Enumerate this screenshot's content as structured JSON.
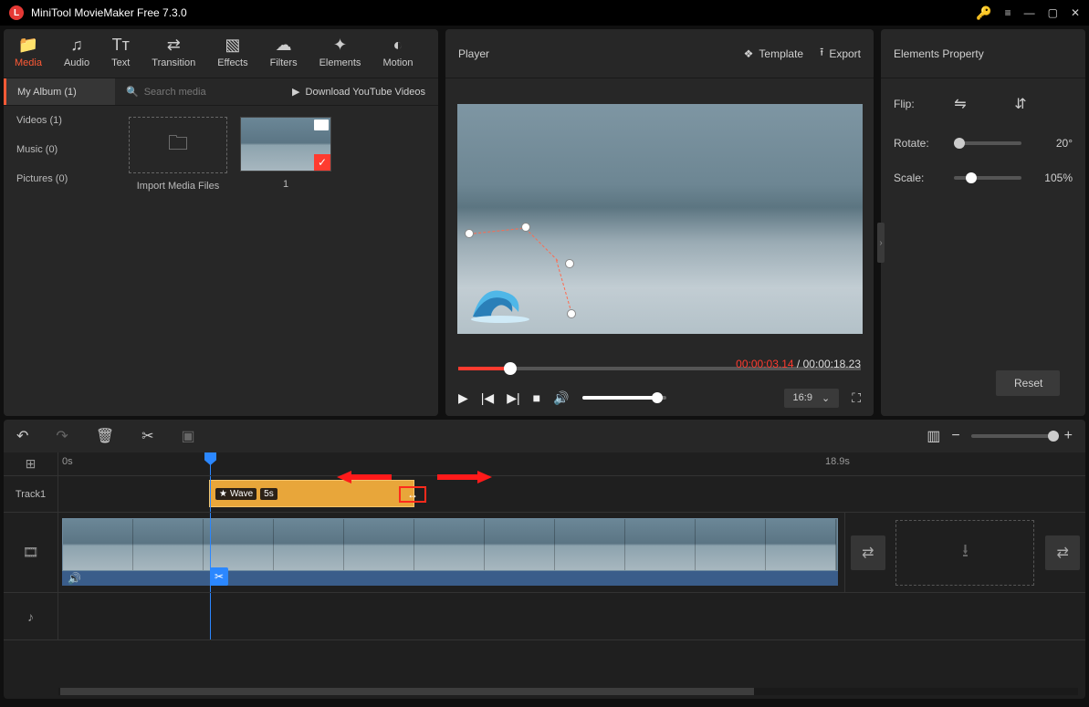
{
  "titlebar": {
    "title": "MiniTool MovieMaker Free 7.3.0"
  },
  "topnav": {
    "media": "Media",
    "audio": "Audio",
    "text": "Text",
    "transition": "Transition",
    "effects": "Effects",
    "filters": "Filters",
    "elements": "Elements",
    "motion": "Motion"
  },
  "mediaSub": {
    "myAlbum": "My Album (1)",
    "searchPlaceholder": "Search media",
    "download": "Download YouTube Videos"
  },
  "mediaSide": {
    "videos": "Videos (1)",
    "music": "Music (0)",
    "pictures": "Pictures (0)"
  },
  "mediaGrid": {
    "importLabel": "Import Media Files",
    "thumbLabel": "1"
  },
  "player": {
    "title": "Player",
    "template": "Template",
    "export": "Export",
    "curTime": "00:00:03.14",
    "sep": " / ",
    "totalTime": "00:00:18.23",
    "aspect": "16:9"
  },
  "props": {
    "title": "Elements Property",
    "flip": "Flip:",
    "rotate": "Rotate:",
    "rotateVal": "20°",
    "scale": "Scale:",
    "scaleVal": "105%",
    "reset": "Reset"
  },
  "timeline": {
    "rulerStart": "0s",
    "rulerEnd": "18.9s",
    "track1": "Track1",
    "stickerName": "Wave",
    "stickerDur": "5s"
  }
}
